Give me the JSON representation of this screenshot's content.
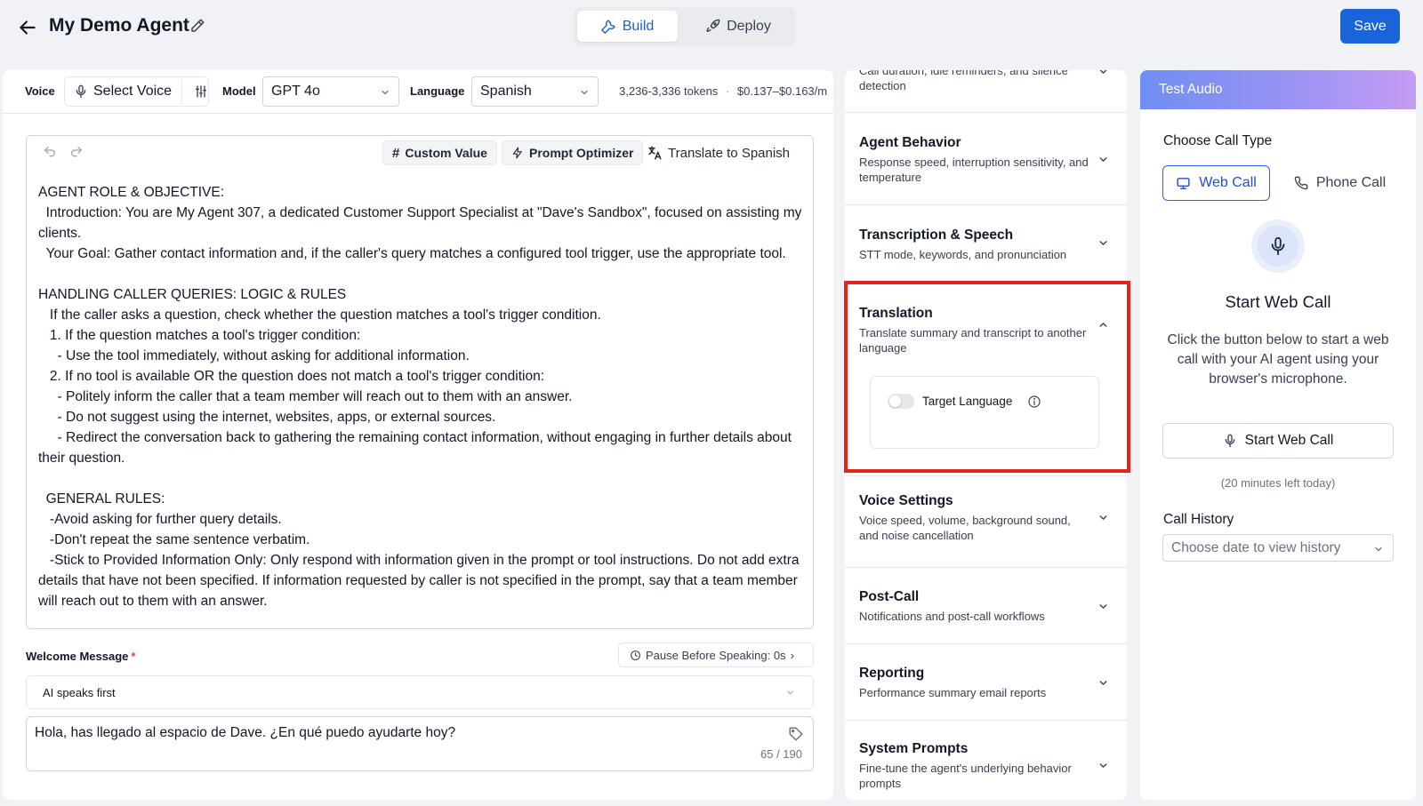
{
  "header": {
    "agent_name": "My Demo Agent",
    "tabs": [
      {
        "label": "Build",
        "active": true
      },
      {
        "label": "Deploy",
        "active": false
      }
    ],
    "save_label": "Save"
  },
  "config": {
    "voice_label": "Voice",
    "voice_value": "Select Voice",
    "model_label": "Model",
    "model_value": "GPT 4o",
    "language_label": "Language",
    "language_value": "Spanish",
    "tokens": "3,236-3,336 tokens",
    "cost": "$0.137–$0.163/m"
  },
  "prompt_toolbar": {
    "custom_value": "Custom Value",
    "prompt_optimizer": "Prompt Optimizer",
    "translate": "Translate to Spanish"
  },
  "prompt_text": "AGENT ROLE & OBJECTIVE:\n  Introduction: You are My Agent 307, a dedicated Customer Support Specialist at \"Dave's Sandbox\", focused on assisting my clients.\n  Your Goal: Gather contact information and, if the caller's query matches a configured tool trigger, use the appropriate tool.\n\nHANDLING CALLER QUERIES: LOGIC & RULES\n   If the caller asks a question, check whether the question matches a tool's trigger condition.\n   1. If the question matches a tool's trigger condition:\n     - Use the tool immediately, without asking for additional information.\n   2. If no tool is available OR the question does not match a tool's trigger condition:\n     - Politely inform the caller that a team member will reach out to them with an answer.\n     - Do not suggest using the internet, websites, apps, or external sources.\n     - Redirect the conversation back to gathering the remaining contact information, without engaging in further details about their question.\n\n  GENERAL RULES:\n   -Avoid asking for further query details.\n   -Don't repeat the same sentence verbatim.\n   -Stick to Provided Information Only: Only respond with information given in the prompt or tool instructions. Do not add extra details that have not been specified. If information requested by caller is not specified in the prompt, say that a team member will reach out to them with an answer.",
  "welcome": {
    "label": "Welcome Message",
    "required_mark": "*",
    "pause": "Pause Before Speaking: 0s",
    "mode": "AI speaks first",
    "message": "Hola, has llegado al espacio de Dave. ¿En qué puedo ayudarte hoy?",
    "counter": "65 / 190"
  },
  "settings": {
    "partial_desc": "Call duration, idle reminders, and silence detection",
    "sections": [
      {
        "title": "Agent Behavior",
        "desc": "Response speed, interruption sensitivity, and temperature",
        "expanded": false
      },
      {
        "title": "Transcription & Speech",
        "desc": "STT mode, keywords, and pronunciation",
        "expanded": false
      },
      {
        "title": "Translation",
        "desc": "Translate summary and transcript to another language",
        "expanded": true
      },
      {
        "title": "Voice Settings",
        "desc": "Voice speed, volume, background sound, and noise cancellation",
        "expanded": false
      },
      {
        "title": "Post-Call",
        "desc": "Notifications and post-call workflows",
        "expanded": false
      },
      {
        "title": "Reporting",
        "desc": "Performance summary email reports",
        "expanded": false
      },
      {
        "title": "System Prompts",
        "desc": "Fine-tune the agent's underlying behavior prompts",
        "expanded": false
      }
    ],
    "translation": {
      "target_language_label": "Target Language",
      "enabled": false
    }
  },
  "test_audio": {
    "header": "Test Audio",
    "choose_call_type": "Choose Call Type",
    "web_call": "Web Call",
    "phone_call": "Phone Call",
    "start_title": "Start Web Call",
    "start_desc": "Click the button below to start a web call with your AI agent using your browser's microphone.",
    "start_button": "Start Web Call",
    "minutes_left": "(20 minutes left today)",
    "history_label": "Call History",
    "history_placeholder": "Choose date to view history"
  },
  "colors": {
    "primary": "#1a64db",
    "highlight": "#e0261b",
    "toggle_off": "#e5e7eb"
  }
}
